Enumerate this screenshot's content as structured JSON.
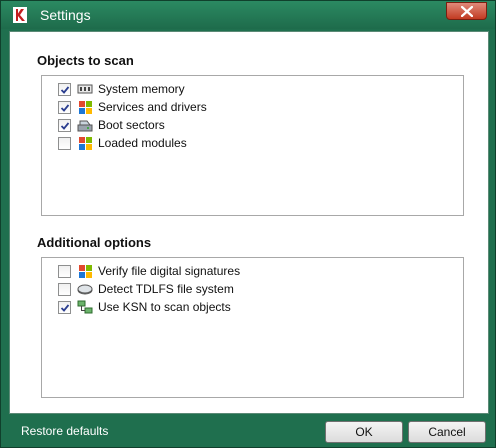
{
  "window": {
    "title": "Settings"
  },
  "objects_section": {
    "title": "Objects to scan",
    "items": [
      {
        "label": "System memory",
        "checked": true,
        "icon": "memory-chip-icon"
      },
      {
        "label": "Services and drivers",
        "checked": true,
        "icon": "windows-flag-icon"
      },
      {
        "label": "Boot sectors",
        "checked": true,
        "icon": "drive-icon"
      },
      {
        "label": "Loaded modules",
        "checked": false,
        "icon": "windows-flag-icon"
      }
    ]
  },
  "options_section": {
    "title": "Additional options",
    "items": [
      {
        "label": "Verify file digital signatures",
        "checked": false,
        "icon": "windows-flag-icon"
      },
      {
        "label": "Detect TDLFS file system",
        "checked": false,
        "icon": "disk-icon"
      },
      {
        "label": "Use KSN to scan objects",
        "checked": true,
        "icon": "network-icon"
      }
    ]
  },
  "footer": {
    "restore_label": "Restore defaults",
    "ok_label": "OK",
    "cancel_label": "Cancel"
  },
  "colors": {
    "frame": "#1f6f4e",
    "client_bg": "#ffffff",
    "check": "#2a3d8f"
  }
}
